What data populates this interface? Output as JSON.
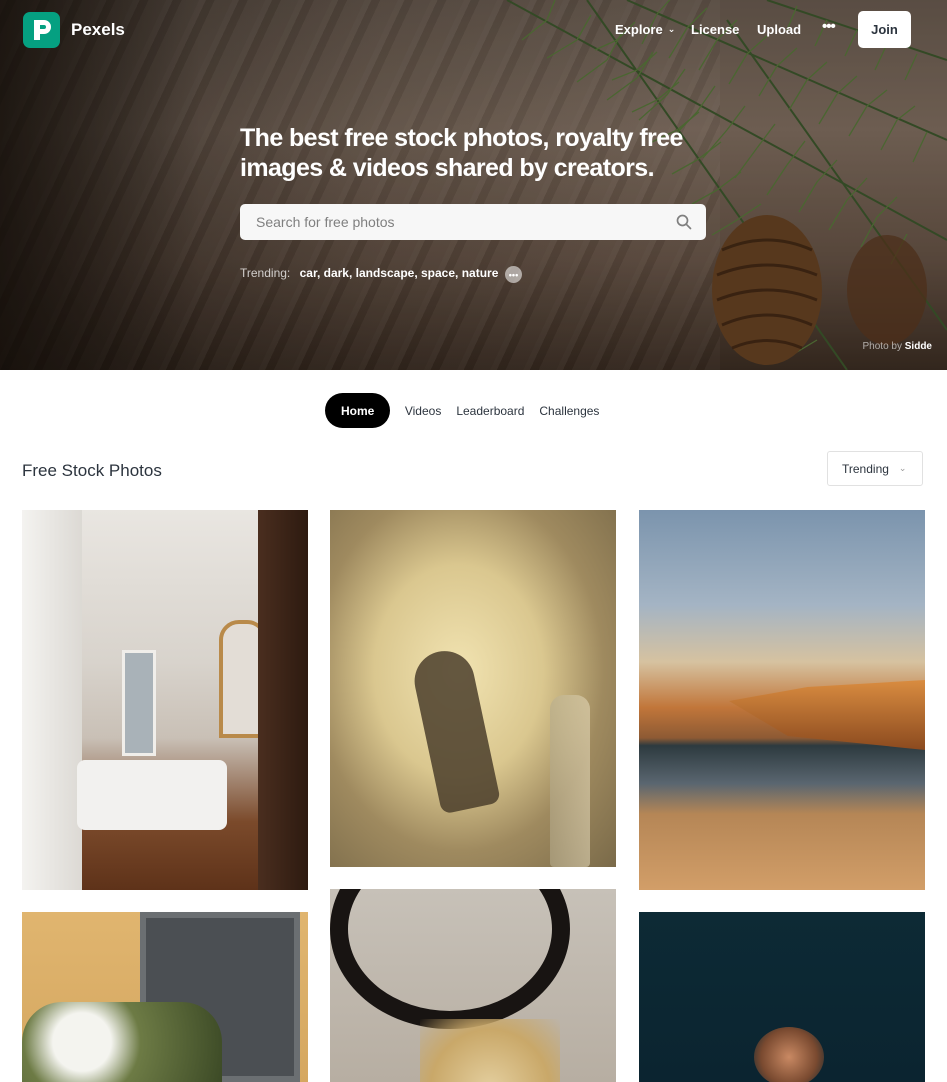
{
  "brand": {
    "name": "Pexels",
    "accent": "#05a081"
  },
  "nav": {
    "explore": "Explore",
    "license": "License",
    "upload": "Upload",
    "more": "•••",
    "join": "Join"
  },
  "hero": {
    "headline": "The best free stock photos, royalty free images & videos shared by creators.",
    "search_placeholder": "Search for free photos",
    "trending_label": "Trending:",
    "trending_tags": "car, dark, landscape, space, nature",
    "photo_by_prefix": "Photo by",
    "photo_by_name": "Sidde"
  },
  "tabs": [
    {
      "label": "Home",
      "active": true
    },
    {
      "label": "Videos",
      "active": false
    },
    {
      "label": "Leaderboard",
      "active": false
    },
    {
      "label": "Challenges",
      "active": false
    }
  ],
  "feed": {
    "title": "Free Stock Photos",
    "sort": "Trending"
  }
}
